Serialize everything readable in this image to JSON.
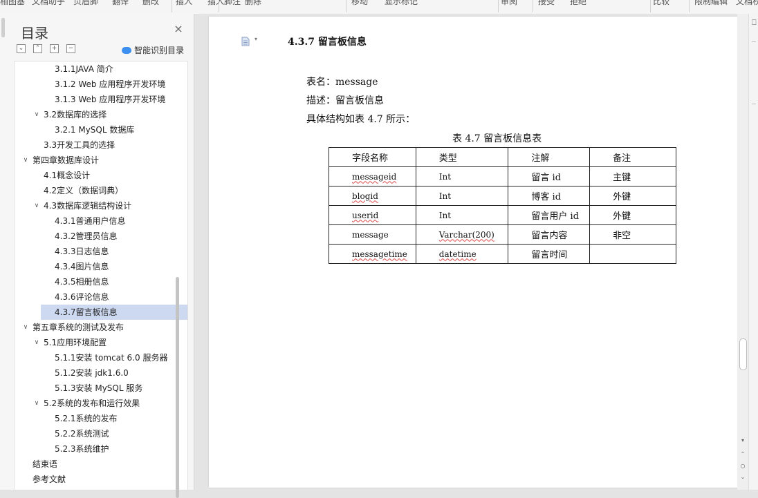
{
  "toolbar": {
    "items": [
      "相图基",
      "文档助手",
      "页眉脚",
      "翻译",
      "删改",
      "插入",
      "插入脚注",
      "删除",
      "移动",
      "显示标记",
      "审阅",
      "接受",
      "拒绝",
      "比较",
      "限制编辑",
      "文档权"
    ]
  },
  "nav": {
    "title": "目录",
    "close_label": "×",
    "tools": [
      "⌄",
      "⌃",
      "+",
      "−"
    ],
    "smart_toc_label": "智能识别目录",
    "items": [
      {
        "label": "3.1.1JAVA 简介",
        "level": 3,
        "chevron": ""
      },
      {
        "label": "3.1.2  Web 应用程序开发环境",
        "level": 3,
        "chevron": ""
      },
      {
        "label": "3.1.3  Web 应用程序开发环境",
        "level": 3,
        "chevron": ""
      },
      {
        "label": "3.2数据库的选择",
        "level": 2,
        "chevron": "∨"
      },
      {
        "label": "3.2.1  MySQL 数据库",
        "level": 3,
        "chevron": ""
      },
      {
        "label": "3.3开发工具的选择",
        "level": 2,
        "chevron": ""
      },
      {
        "label": "第四章数据库设计",
        "level": 1,
        "chevron": "∨"
      },
      {
        "label": "4.1概念设计",
        "level": 2,
        "chevron": ""
      },
      {
        "label": "4.2定义（数据词典）",
        "level": 2,
        "chevron": ""
      },
      {
        "label": "4.3数据库逻辑结构设计",
        "level": 2,
        "chevron": "∨"
      },
      {
        "label": "4.3.1普通用户信息",
        "level": 3,
        "chevron": ""
      },
      {
        "label": "4.3.2管理员信息",
        "level": 3,
        "chevron": ""
      },
      {
        "label": "4.3.3日志信息",
        "level": 3,
        "chevron": ""
      },
      {
        "label": "4.3.4图片信息",
        "level": 3,
        "chevron": ""
      },
      {
        "label": "4.3.5相册信息",
        "level": 3,
        "chevron": ""
      },
      {
        "label": "4.3.6评论信息",
        "level": 3,
        "chevron": ""
      },
      {
        "label": "4.3.7留言板信息",
        "level": 3,
        "chevron": "",
        "active": true
      },
      {
        "label": "第五章系统的测试及发布",
        "level": 1,
        "chevron": "∨"
      },
      {
        "label": "5.1应用环境配置",
        "level": 2,
        "chevron": "∨"
      },
      {
        "label": "5.1.1安装 tomcat 6.0 服务器",
        "level": 3,
        "chevron": ""
      },
      {
        "label": "5.1.2安装 jdk1.6.0",
        "level": 3,
        "chevron": ""
      },
      {
        "label": "5.1.3安装 MySQL 服务",
        "level": 3,
        "chevron": ""
      },
      {
        "label": "5.2系统的发布和运行效果",
        "level": 2,
        "chevron": "∨"
      },
      {
        "label": "5.2.1系统的发布",
        "level": 3,
        "chevron": ""
      },
      {
        "label": "5.2.2系统测试",
        "level": 3,
        "chevron": ""
      },
      {
        "label": "5.2.3系统维护",
        "level": 3,
        "chevron": ""
      },
      {
        "label": "结束语",
        "level": 1,
        "chevron": ""
      },
      {
        "label": "参考文献",
        "level": 1,
        "chevron": ""
      }
    ]
  },
  "document": {
    "heading": "4.3.7 留言板信息",
    "paragraphs": [
      "表名：message",
      "描述：留言板信息",
      "具体结构如表 4.7 所示："
    ],
    "table_caption": "表 4.7 留言板信息表",
    "table": {
      "headers": [
        "字段名称",
        "类型",
        "注解",
        "备注"
      ],
      "rows": [
        [
          "messageid",
          "Int",
          "留言 id",
          "主键"
        ],
        [
          "blogid",
          "Int",
          "博客 id",
          "外键"
        ],
        [
          "userid",
          "Int",
          "留言用户 id",
          "外键"
        ],
        [
          "message",
          "Varchar(200)",
          "留言内容",
          "非空"
        ],
        [
          "messagetime",
          "datetime",
          "留言时间",
          ""
        ]
      ]
    }
  },
  "colors": {
    "active_bg": "#cdd9f1",
    "spell_underline": "#e04848",
    "accent": "#3d8ff0"
  }
}
